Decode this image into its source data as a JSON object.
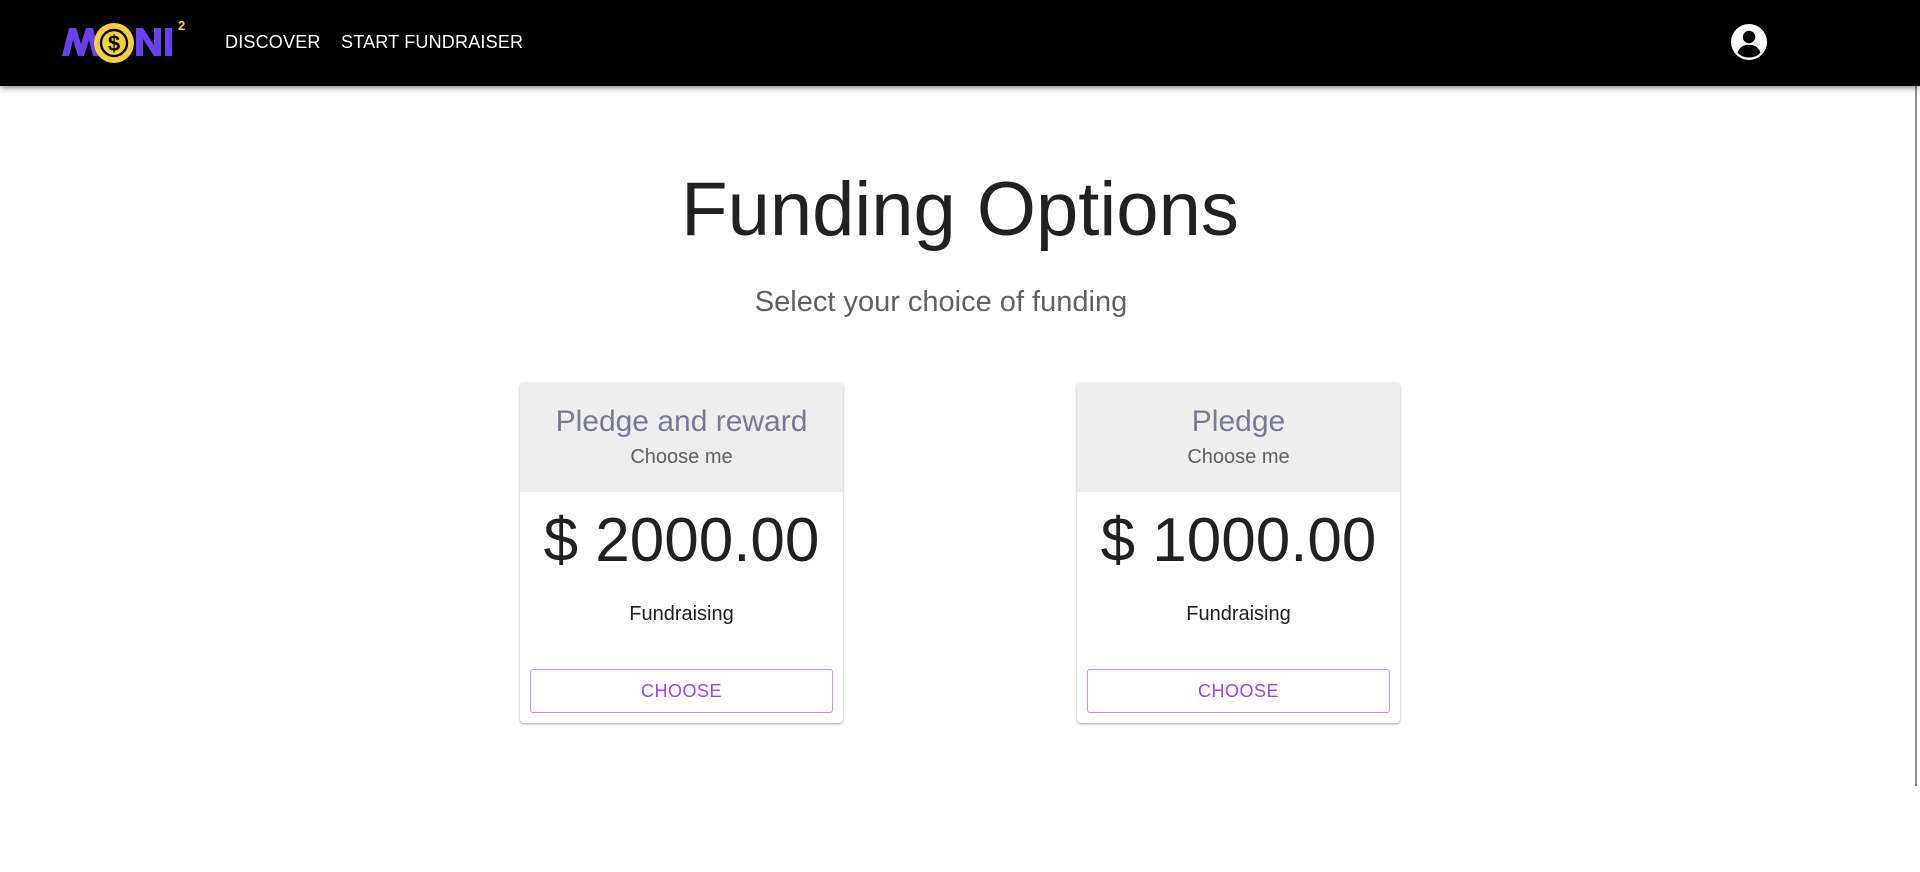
{
  "header": {
    "logo_text": "MONI²",
    "nav": {
      "discover": "DISCOVER",
      "start_fundraiser": "START FUNDRAISER"
    },
    "account_icon": "account-circle-icon"
  },
  "main": {
    "title": "Funding Options",
    "subtitle": "Select your choice of funding"
  },
  "cards": [
    {
      "title": "Pledge and reward",
      "subtitle": "Choose me",
      "price": "$ 2000.00",
      "description": "Fundraising",
      "button": "CHOOSE"
    },
    {
      "title": "Pledge",
      "subtitle": "Choose me",
      "price": "$ 1000.00",
      "description": "Fundraising",
      "button": "CHOOSE"
    }
  ],
  "colors": {
    "header_bg": "#000000",
    "logo_purple": "#6a3ff0",
    "logo_yellow": "#f5d03b",
    "button_accent": "#a342e6",
    "card_header_bg": "#eeeeee"
  }
}
